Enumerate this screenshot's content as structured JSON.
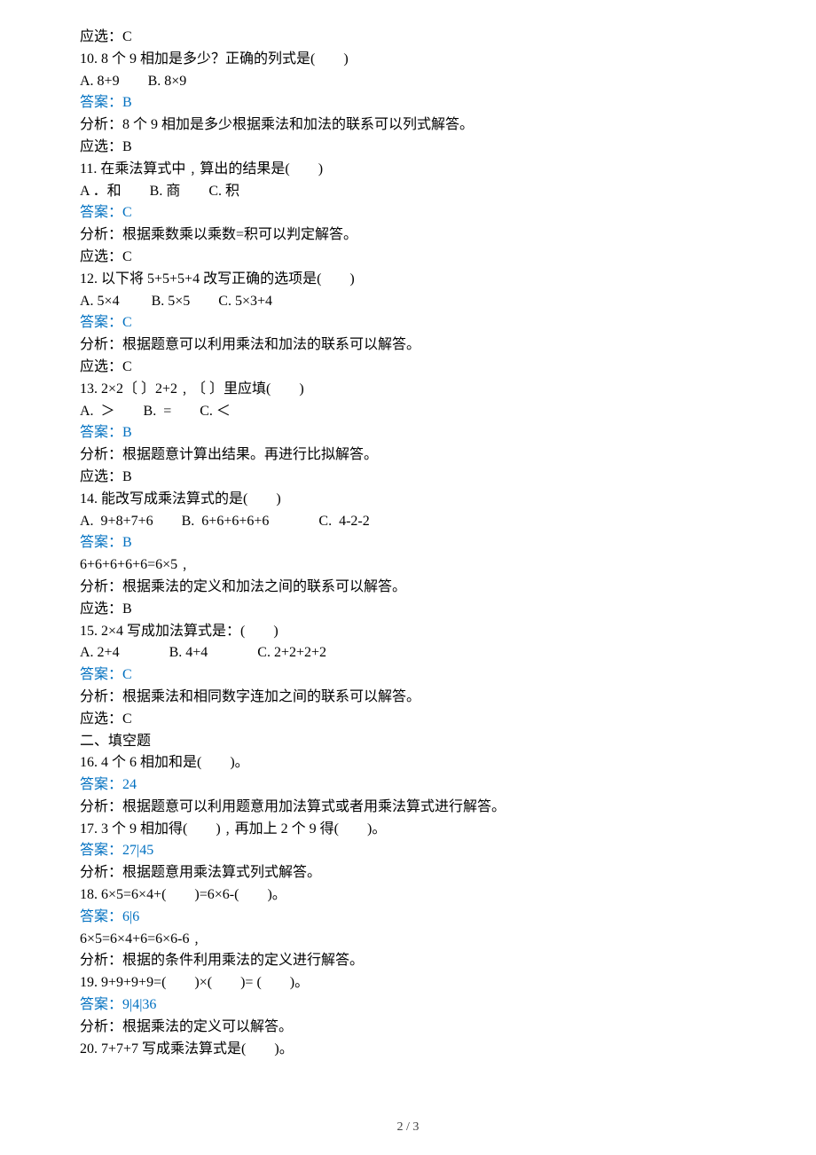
{
  "lines": [
    {
      "t": "应选：C"
    },
    {
      "t": "10. 8 个 9 相加是多少？正确的列式是(　　)"
    },
    {
      "t": "A. 8+9        B. 8×9"
    },
    {
      "t": "答案：B",
      "cls": "answer"
    },
    {
      "t": "分析：8 个 9 相加是多少根据乘法和加法的联系可以列式解答。"
    },
    {
      "t": "应选：B"
    },
    {
      "t": "11. 在乘法算式中﹐算出的结果是(　　)"
    },
    {
      "t": "A ．和        B. 商        C. 积"
    },
    {
      "t": "答案：C",
      "cls": "answer"
    },
    {
      "t": "分析：根据乘数乘以乘数=积可以判定解答。"
    },
    {
      "t": "应选：C"
    },
    {
      "t": "12. 以下将 5+5+5+4 改写正确的选项是(　　)"
    },
    {
      "t": "A. 5×4         B. 5×5        C. 5×3+4"
    },
    {
      "t": "答案：C",
      "cls": "answer"
    },
    {
      "t": "分析：根据题意可以利用乘法和加法的联系可以解答。"
    },
    {
      "t": "应选：C"
    },
    {
      "t": "13. 2×2〔 〕2+2﹐〔 〕里应填(　　)"
    },
    {
      "t": "A.  ＞        B.  =        C. ＜"
    },
    {
      "t": "答案：B",
      "cls": "answer"
    },
    {
      "t": "分析：根据题意计算出结果。再进行比拟解答。"
    },
    {
      "t": "应选：B"
    },
    {
      "t": "14. 能改写成乘法算式的是(　　)"
    },
    {
      "t": "A.  9+8+7+6        B.  6+6+6+6+6              C.  4-2-2"
    },
    {
      "t": "答案：B",
      "cls": "answer"
    },
    {
      "t": "6+6+6+6+6=6×5﹐"
    },
    {
      "t": "分析：根据乘法的定义和加法之间的联系可以解答。"
    },
    {
      "t": "应选：B"
    },
    {
      "t": "15. 2×4 写成加法算式是：(　　)"
    },
    {
      "t": "A. 2+4              B. 4+4              C. 2+2+2+2"
    },
    {
      "t": "答案：C",
      "cls": "answer"
    },
    {
      "t": "分析：根据乘法和相同数字连加之间的联系可以解答。"
    },
    {
      "t": "应选：C"
    },
    {
      "t": "二、填空题"
    },
    {
      "t": "16. 4 个 6 相加和是(　　)。"
    },
    {
      "t": "答案：24",
      "cls": "answer"
    },
    {
      "t": "分析：根据题意可以利用题意用加法算式或者用乘法算式进行解答。"
    },
    {
      "t": "17. 3 个 9 相加得(　　)﹐再加上 2 个 9 得(　　)。"
    },
    {
      "t": "答案：27|45",
      "cls": "answer"
    },
    {
      "t": "分析：根据题意用乘法算式列式解答。"
    },
    {
      "t": "18. 6×5=6×4+(　　)=6×6-(　　)。"
    },
    {
      "t": "答案：6|6",
      "cls": "answer"
    },
    {
      "t": "6×5=6×4+6=6×6-6﹐"
    },
    {
      "t": "分析：根据的条件利用乘法的定义进行解答。"
    },
    {
      "t": "19. 9+9+9+9=(　　)×(　　)= (　　)。"
    },
    {
      "t": "答案：9|4|36",
      "cls": "answer"
    },
    {
      "t": "分析：根据乘法的定义可以解答。"
    },
    {
      "t": "20. 7+7+7 写成乘法算式是(　　)。"
    }
  ],
  "footer": "2 / 3"
}
